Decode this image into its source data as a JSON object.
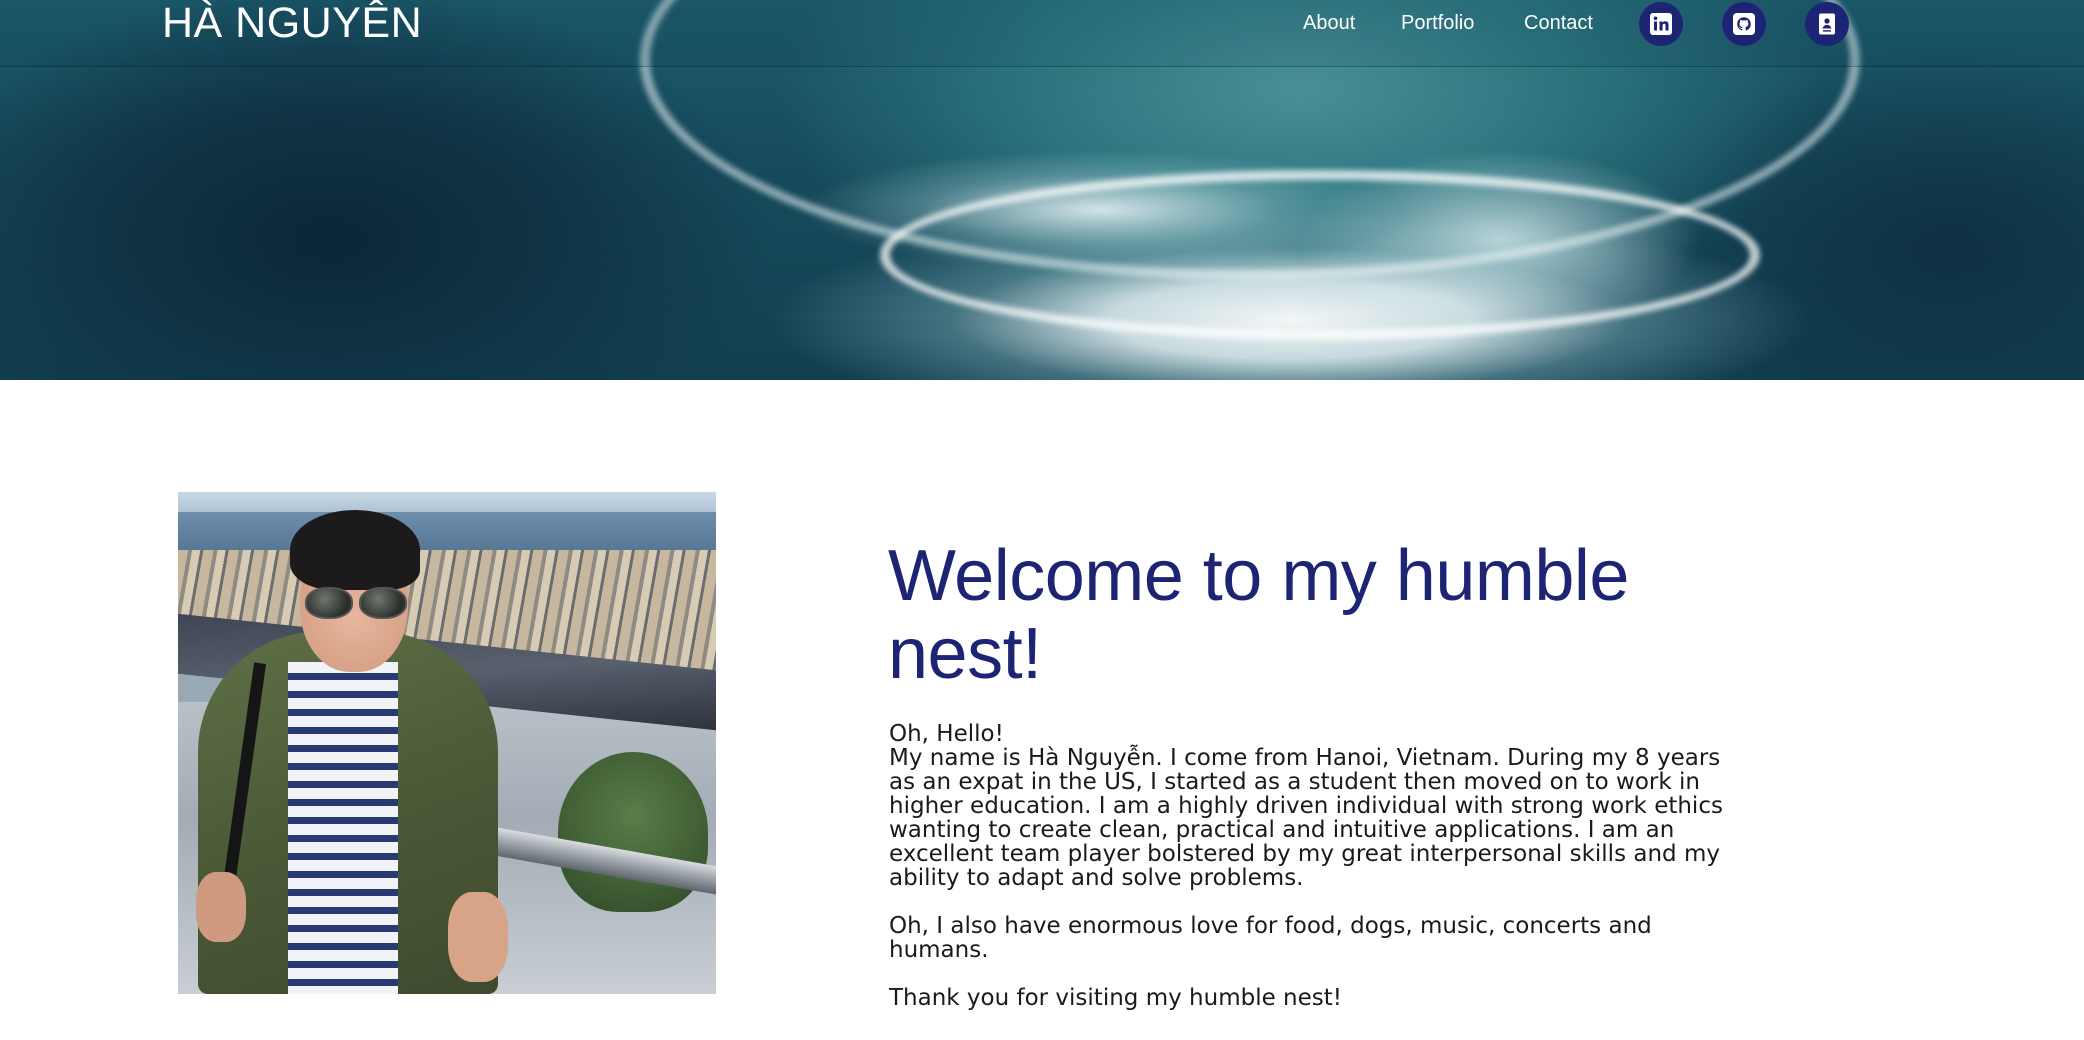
{
  "header": {
    "logo": "HÀ NGUYÊN",
    "nav": [
      {
        "label": "About"
      },
      {
        "label": "Portfolio"
      },
      {
        "label": "Contact"
      }
    ],
    "icons": [
      {
        "name": "linkedin-icon"
      },
      {
        "name": "github-icon"
      },
      {
        "name": "resume-icon"
      }
    ]
  },
  "hero": {
    "image": "ocean-wave-banner"
  },
  "about": {
    "photo": "portrait-photo",
    "heading": "Welcome to my humble nest!",
    "greeting": "Oh, Hello!",
    "intro": "My name is Hà Nguyễn. I come from Hanoi, Vietnam. During my 8 years as an expat in the US, I started as a student then moved on to work in higher education. I am a highly driven individual with strong work ethics wanting to create clean, practical and intuitive applications. I am an excellent team player bolstered by my great interpersonal skills and my ability to adapt and solve problems.",
    "hobbies": "Oh, I also have enormous love for food, dogs, music, concerts and humans.",
    "thanks": "Thank you for visiting my humble nest!"
  },
  "colors": {
    "accent": "#1d2473",
    "text": "#1a1a1a",
    "nav_text": "#ffffff"
  }
}
